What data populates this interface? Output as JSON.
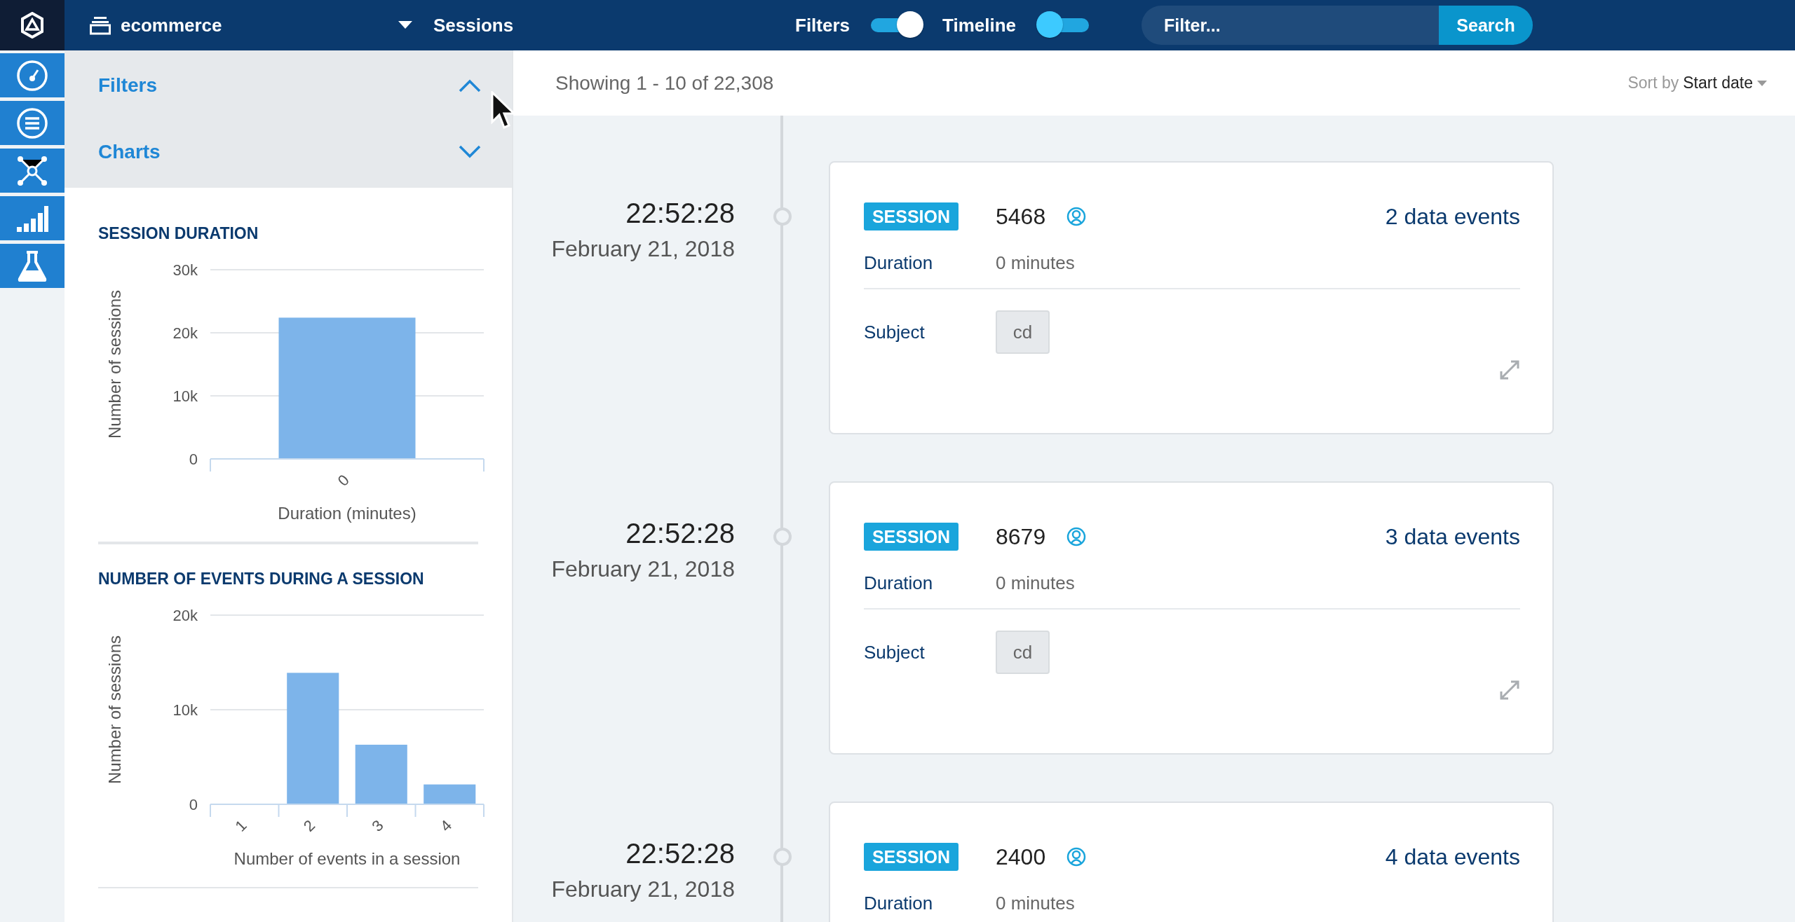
{
  "app": {
    "project": "ecommerce",
    "page": "Sessions"
  },
  "toggles": [
    {
      "label": "Filters",
      "on": true
    },
    {
      "label": "Timeline",
      "on": false
    }
  ],
  "search": {
    "placeholder": "Filter...",
    "button": "Search"
  },
  "panels": [
    {
      "title": "Filters",
      "expanded": true
    },
    {
      "title": "Charts",
      "expanded": false
    }
  ],
  "charts": [
    {
      "title": "SESSION DURATION",
      "chart_data": {
        "type": "bar",
        "xlabel": "Duration (minutes)",
        "ylabel": "Number of sessions",
        "categories": [
          "0"
        ],
        "values": [
          22400
        ],
        "ylim": [
          0,
          30000
        ],
        "yticks": [
          {
            "value": 0,
            "label": "0"
          },
          {
            "value": 10000,
            "label": "10k"
          },
          {
            "value": 20000,
            "label": "20k"
          },
          {
            "value": 30000,
            "label": "30k"
          }
        ]
      }
    },
    {
      "title": "NUMBER OF EVENTS DURING A SESSION",
      "chart_data": {
        "type": "bar",
        "xlabel": "Number of events in a session",
        "ylabel": "Number of sessions",
        "categories": [
          "1",
          "2",
          "3",
          "4"
        ],
        "values": [
          0,
          13900,
          6300,
          2100
        ],
        "ylim": [
          0,
          20000
        ],
        "yticks": [
          {
            "value": 0,
            "label": "0"
          },
          {
            "value": 10000,
            "label": "10k"
          },
          {
            "value": 20000,
            "label": "20k"
          }
        ]
      }
    }
  ],
  "results": {
    "summary": "Showing 1 - 10 of 22,308",
    "sort_label": "Sort by",
    "sort_value": "Start date"
  },
  "sessions": [
    {
      "time": "22:52:28",
      "date": "February 21, 2018",
      "badge": "SESSION",
      "id": "5468",
      "events": "2 data events",
      "fields": [
        {
          "label": "Duration",
          "value": "0 minutes"
        }
      ],
      "subject_label": "Subject",
      "subject": "cd"
    },
    {
      "time": "22:52:28",
      "date": "February 21, 2018",
      "badge": "SESSION",
      "id": "8679",
      "events": "3 data events",
      "fields": [
        {
          "label": "Duration",
          "value": "0 minutes"
        }
      ],
      "subject_label": "Subject",
      "subject": "cd"
    },
    {
      "time": "22:52:28",
      "date": "February 21, 2018",
      "badge": "SESSION",
      "id": "2400",
      "events": "4 data events",
      "fields": [
        {
          "label": "Duration",
          "value": "0 minutes"
        }
      ]
    }
  ]
}
